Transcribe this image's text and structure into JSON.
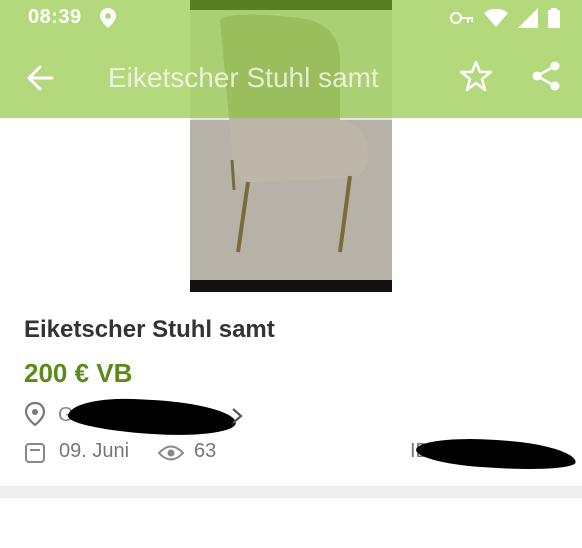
{
  "status_bar": {
    "time": "08:39",
    "icons": [
      "location-icon",
      "key-icon",
      "wifi-icon",
      "signal-icon",
      "battery-icon"
    ]
  },
  "toolbar": {
    "title": "Eiketscher Stuhl samt",
    "back_icon": "back-arrow-icon",
    "favorite_icon": "star-outline-icon",
    "share_icon": "share-icon",
    "accent_color": "#86c22d"
  },
  "listing": {
    "title": "Eiketscher Stuhl samt",
    "price": "200 € VB",
    "price_color": "#5a8a1a",
    "location": "Gütersloh",
    "date": "09. Juni",
    "views": "63",
    "id_label": "ID"
  }
}
